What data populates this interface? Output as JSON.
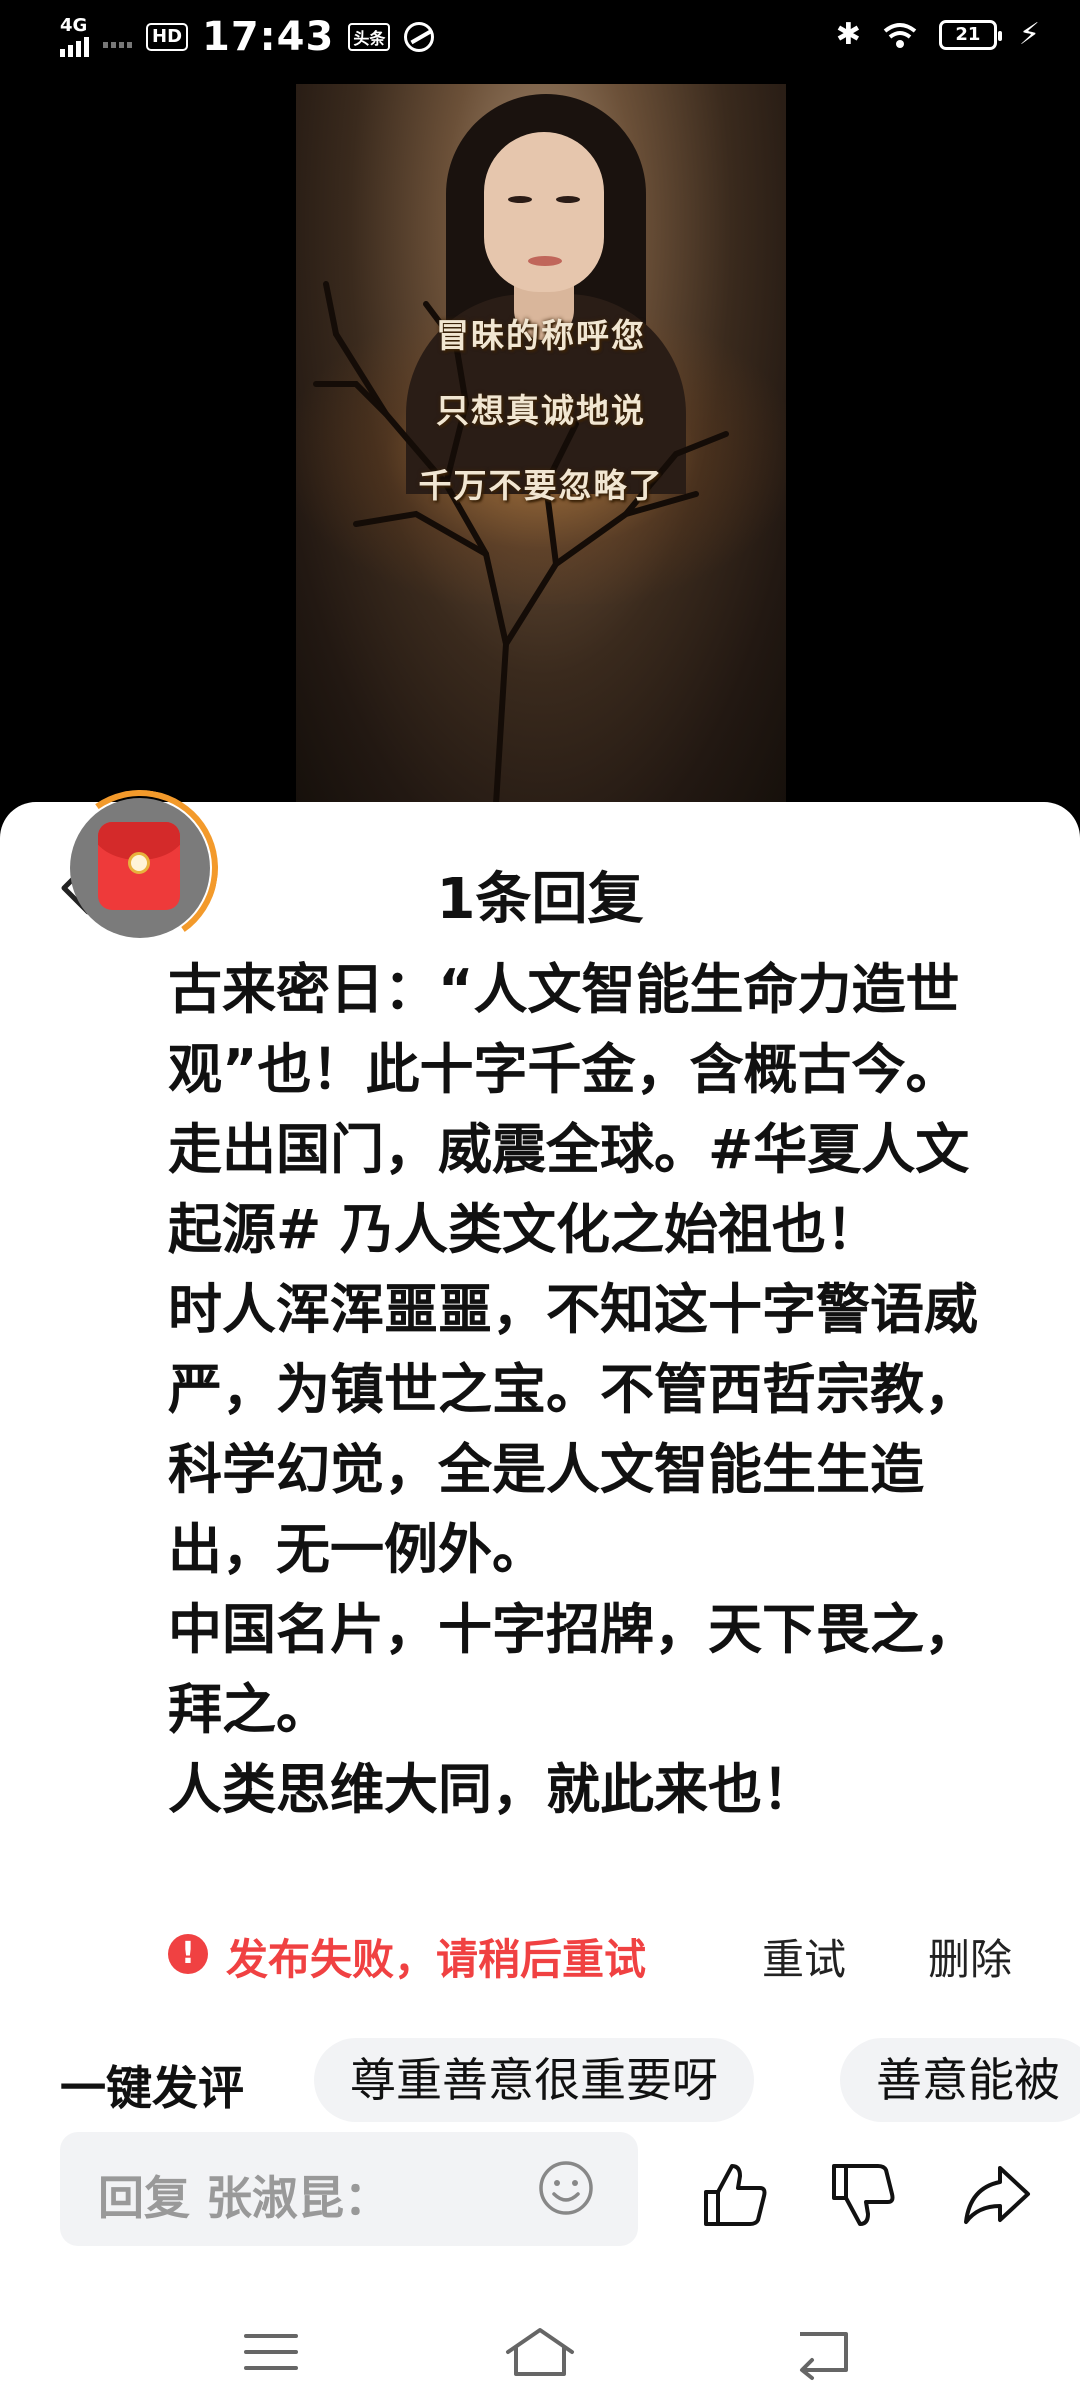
{
  "status_bar": {
    "network": "4G",
    "hd": "HD",
    "time": "17:43",
    "app_badge": "头条",
    "battery": "21"
  },
  "video": {
    "captions": [
      "冒昧的称呼您",
      "只想真诚地说",
      "千万不要忽略了"
    ]
  },
  "sheet": {
    "title": "1条回复",
    "comment_paragraphs": [
      "古来密日：“人文智能生命力造世观”也！此十字千金，含概古今。走出国门，威震全球。#华夏人文起源# 乃人类文化之始祖也！",
      "时人浑浑噩噩，不知这十字警语威严，为镇世之宝。不管西哲宗教，科学幻觉，全是人文智能生生造出，无一例外。",
      "中国名片，十字招牌，天下畏之，拜之。",
      "人类思维大同，就此来也！"
    ],
    "status": {
      "error_text": "发布失败，请稍后重试",
      "retry_label": "重试",
      "delete_label": "删除"
    },
    "quick_comment": {
      "label": "一键发评",
      "chips": [
        "尊重善意很重要呀",
        "善意能被"
      ]
    },
    "reply_input": {
      "placeholder": "回复 张淑昆："
    }
  },
  "colors": {
    "error": "#f04142",
    "chip_bg": "#f2f3f5",
    "redpacket": "#ee3a3a",
    "progress_ring": "#f39a2b"
  }
}
